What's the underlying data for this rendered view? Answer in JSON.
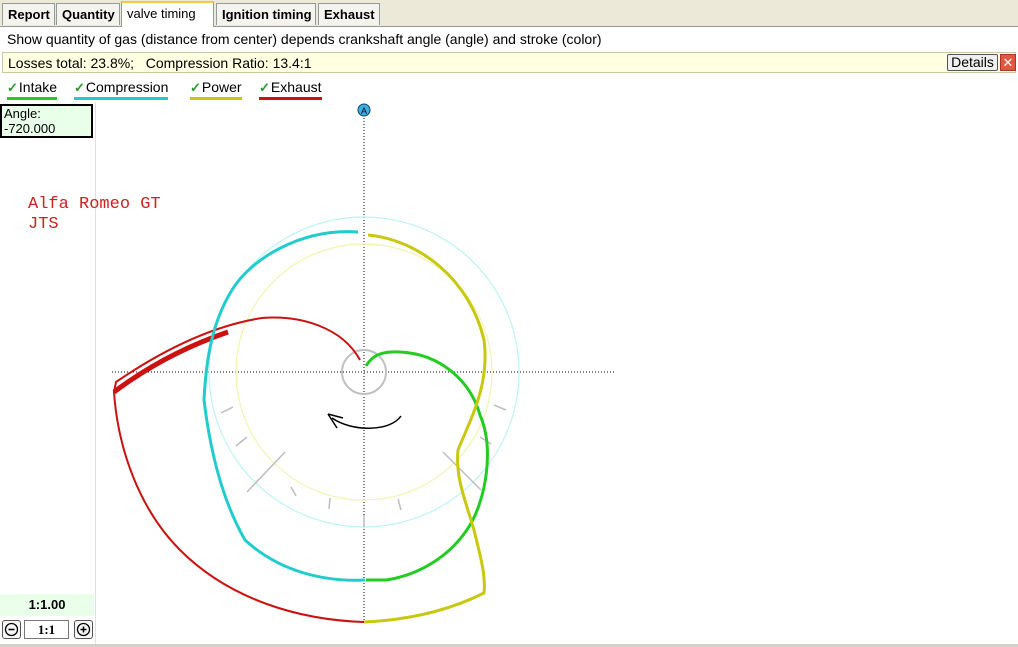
{
  "tabs": [
    {
      "label": "Report",
      "active": false
    },
    {
      "label": "Quantity",
      "active": false
    },
    {
      "label": "valve timing",
      "active": true
    },
    {
      "label": "Ignition timing",
      "active": false
    },
    {
      "label": "Exhaust",
      "active": false
    }
  ],
  "description": "Show quantity of gas (distance from center) depends crankshaft angle (angle) and stroke (color)",
  "losses": {
    "text": "Losses total: 23.8%;   Compression Ratio: 13.4:1",
    "details_label": "Details",
    "close_glyph": "✕"
  },
  "strokes": [
    {
      "label": "Intake",
      "checked": true,
      "color": "#22cc22"
    },
    {
      "label": "Compression",
      "checked": true,
      "color": "#22cccc"
    },
    {
      "label": "Power",
      "checked": true,
      "color": "#c8c810"
    },
    {
      "label": "Exhaust",
      "checked": true,
      "color": "#cc1111"
    }
  ],
  "angle": {
    "label": "Angle:",
    "value": "-720.000"
  },
  "scale": {
    "ratio": "1:1.00",
    "zoom": "1:1"
  },
  "car_name": "Alfa Romeo GT\nJTS",
  "marker_label": "A",
  "icons": {
    "check": "checkmark-icon",
    "zoom_out": "minus-circle-icon",
    "zoom_in": "plus-circle-icon",
    "close": "close-icon",
    "rotation": "rotation-arrow-icon"
  }
}
